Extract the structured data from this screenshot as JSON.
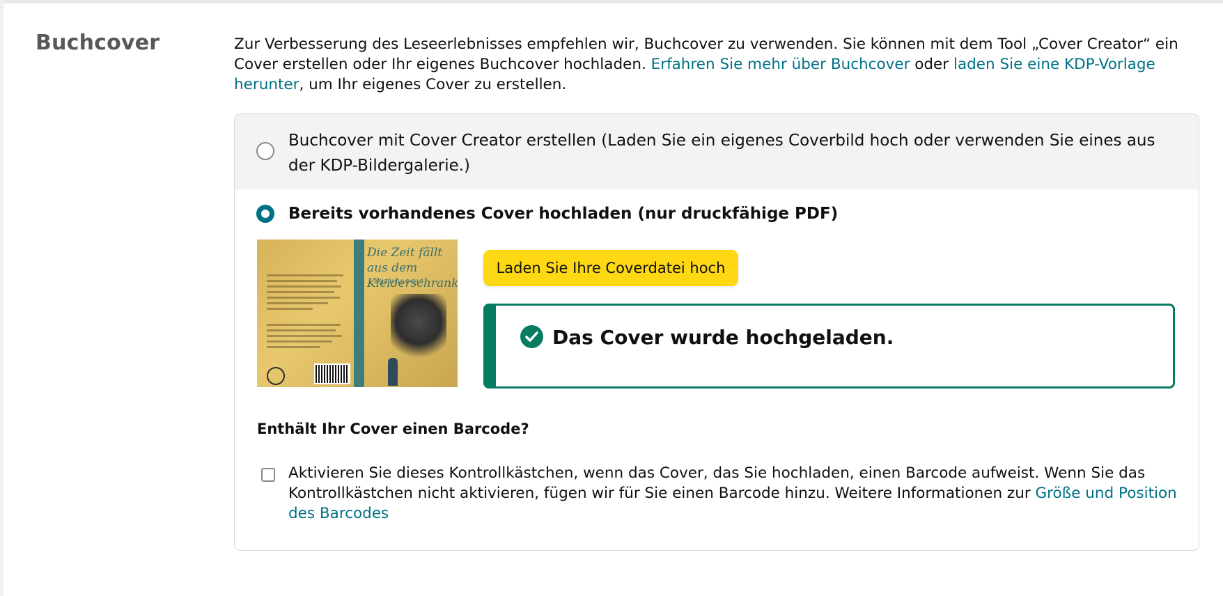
{
  "section": {
    "heading": "Buchcover"
  },
  "intro": {
    "text_1": "Zur Verbesserung des Leseerlebnisses empfehlen wir, Buchcover zu verwenden. Sie können mit dem Tool „Cover Creator“ ein Cover erstellen oder Ihr eigenes Buchcover hochladen. ",
    "link_1": "Erfahren Sie mehr über Buchcover",
    "text_2": " oder ",
    "link_2": "laden Sie eine KDP-Vorlage herunter",
    "text_3": ", um Ihr eigenes Cover zu erstellen."
  },
  "options": {
    "cover_creator": {
      "label": "Buchcover mit Cover Creator erstellen (Laden Sie ein eigenes Coverbild hoch oder verwenden Sie eines aus der KDP-Bildergalerie.)",
      "selected": false
    },
    "upload_existing": {
      "label": "Bereits vorhandenes Cover hochladen (nur druckfähige PDF)",
      "selected": true
    }
  },
  "cover_preview": {
    "title": "Die Zeit fällt aus dem Kleiderschrank",
    "subtitle": "ANTHOLOGIE"
  },
  "upload": {
    "button_label": "Laden Sie Ihre Coverdatei hoch",
    "success_message": "Das Cover wurde hochgeladen.",
    "success_icon": "check-circle-icon"
  },
  "barcode": {
    "question": "Enthält Ihr Cover einen Barcode?",
    "checkbox_text": "Aktivieren Sie dieses Kontrollkästchen, wenn das Cover, das Sie hochladen, einen Barcode aufweist. Wenn Sie das Kontrollkästchen nicht aktivieren, fügen wir für Sie einen Barcode hinzu. Weitere Informationen zur ",
    "checkbox_link": "Größe und Position des Barcodes",
    "checked": false
  },
  "colors": {
    "link": "#007185",
    "primary_button": "#FFD814",
    "success": "#067D62",
    "radio_selected": "#007185"
  }
}
